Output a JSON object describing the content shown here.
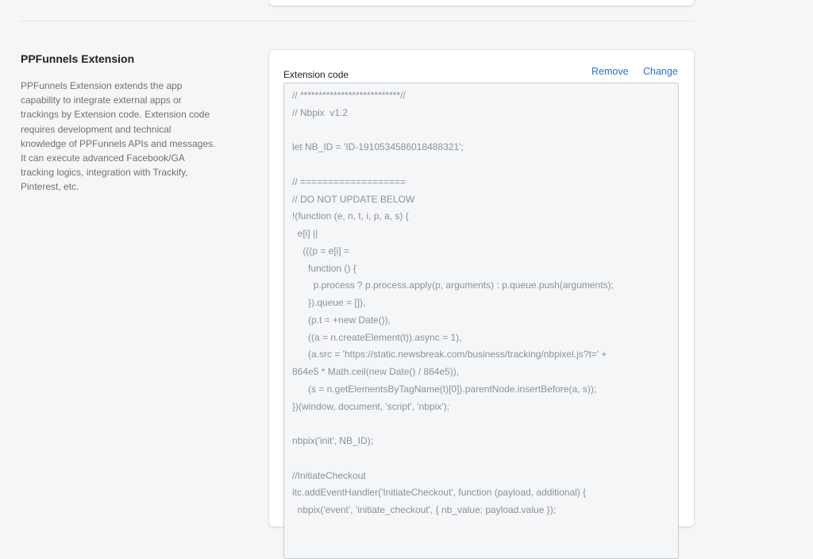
{
  "section": {
    "title": "PPFunnels Extension",
    "description": "PPFunnels Extension extends the app capability to integrate external apps or trackings by Extension code. Extension code requires development and technical knowledge of PPFunnels APIs and messages. It can execute advanced Facebook/GA tracking logics, integration with Trackify, Pinterest, etc."
  },
  "card": {
    "label": "Extension code",
    "remove_label": "Remove",
    "change_label": "Change"
  },
  "code_lines": [
    "// ***************************//",
    "// Nbpix  v1.2",
    "",
    "let NB_ID = 'ID-1910534586018488321';",
    "",
    "// ===================",
    "// DO NOT UPDATE BELOW",
    "!(function (e, n, t, i, p, a, s) {",
    "  e[i] ||",
    "    (((p = e[i] =",
    "      function () {",
    "        p.process ? p.process.apply(p, arguments) : p.queue.push(arguments);",
    "      }).queue = []),",
    "      (p.t = +new Date()),",
    "      ((a = n.createElement(t)).async = 1),",
    "      (a.src = 'https://static.newsbreak.com/business/tracking/nbpixel.js?t=' +",
    "864e5 * Math.ceil(new Date() / 864e5)),",
    "      (s = n.getElementsByTagName(t)[0]).parentNode.insertBefore(a, s));",
    "})(window, document, 'script', 'nbpix');",
    "",
    "nbpix('init', NB_ID);",
    "",
    "//InitiateCheckout",
    "itc.addEventHandler('InitiateCheckout', function (payload, additional) {",
    "  nbpix('event', 'initiate_checkout', { nb_value: payload.value });"
  ]
}
